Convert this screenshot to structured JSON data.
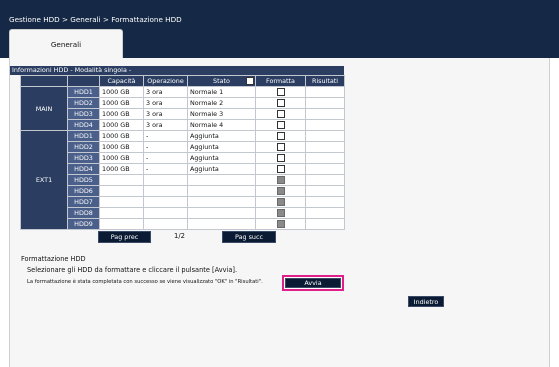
{
  "breadcrumb": "Gestione HDD > Generali > Formattazione HDD",
  "tabs": [
    {
      "label": "Generali"
    }
  ],
  "section_title": "Informazioni HDD - Modalità singola -",
  "table": {
    "headers": {
      "capacity": "Capacità",
      "operation": "Operazione",
      "state": "Stato",
      "format": "Formatta",
      "results": "Risultati"
    },
    "groups": [
      {
        "name": "MAIN",
        "rows": [
          {
            "hdd": "HDD1",
            "capacity": "1000 GB",
            "operation": "3 ora",
            "state": "Normale 1",
            "format_enabled": true
          },
          {
            "hdd": "HDD2",
            "capacity": "1000 GB",
            "operation": "3 ora",
            "state": "Normale 2",
            "format_enabled": true
          },
          {
            "hdd": "HDD3",
            "capacity": "1000 GB",
            "operation": "3 ora",
            "state": "Normale 3",
            "format_enabled": true
          },
          {
            "hdd": "HDD4",
            "capacity": "1000 GB",
            "operation": "3 ora",
            "state": "Normale 4",
            "format_enabled": true
          }
        ]
      },
      {
        "name": "EXT1",
        "rows": [
          {
            "hdd": "HDD1",
            "capacity": "1000 GB",
            "operation": "-",
            "state": "Aggiunta",
            "format_enabled": true
          },
          {
            "hdd": "HDD2",
            "capacity": "1000 GB",
            "operation": "-",
            "state": "Aggiunta",
            "format_enabled": true
          },
          {
            "hdd": "HDD3",
            "capacity": "1000 GB",
            "operation": "-",
            "state": "Aggiunta",
            "format_enabled": true
          },
          {
            "hdd": "HDD4",
            "capacity": "1000 GB",
            "operation": "-",
            "state": "Aggiunta",
            "format_enabled": true
          },
          {
            "hdd": "HDD5",
            "capacity": "",
            "operation": "",
            "state": "",
            "format_enabled": false
          },
          {
            "hdd": "HDD6",
            "capacity": "",
            "operation": "",
            "state": "",
            "format_enabled": false
          },
          {
            "hdd": "HDD7",
            "capacity": "",
            "operation": "",
            "state": "",
            "format_enabled": false
          },
          {
            "hdd": "HDD8",
            "capacity": "",
            "operation": "",
            "state": "",
            "format_enabled": false
          },
          {
            "hdd": "HDD9",
            "capacity": "",
            "operation": "",
            "state": "",
            "format_enabled": false
          }
        ]
      }
    ]
  },
  "pagination": {
    "prev_label": "Pag prec",
    "indicator": "1/2",
    "next_label": "Pag succ"
  },
  "formatting": {
    "title": "Formattazione HDD",
    "instruction": "Selezionare gli HDD da formattare e cliccare il pulsante [Avvia].",
    "note": "La formattazione è stata completata con successo se viene visualizzato \"OK\" in \"Risultati\".",
    "start_label": "Avvia"
  },
  "back_label": "Indietro",
  "colors": {
    "header_bg": "#152845",
    "table_header": "#2b3d61",
    "highlight_frame": "#e0208a"
  }
}
